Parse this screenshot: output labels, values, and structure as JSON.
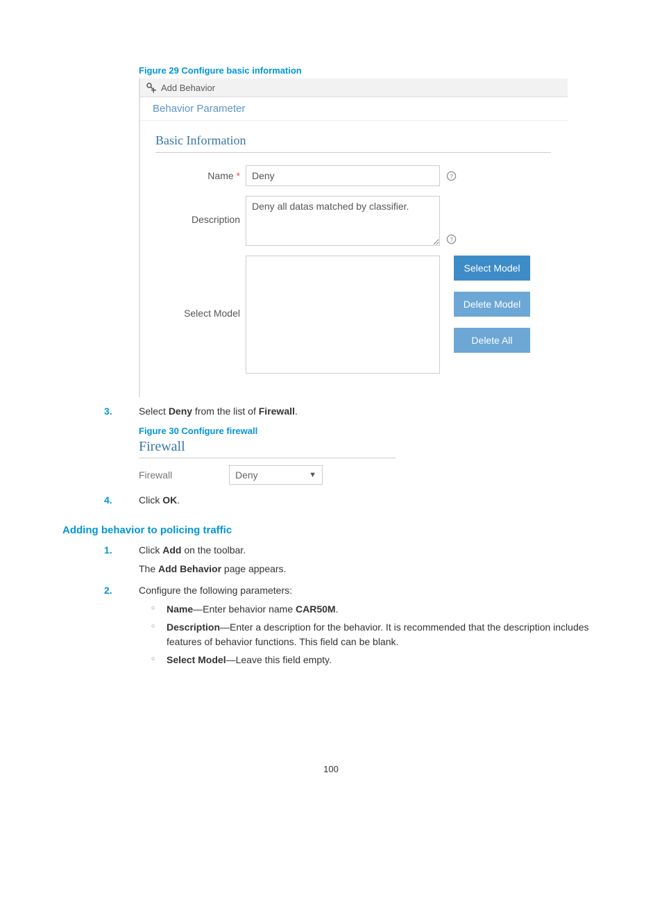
{
  "figure29_caption": "Figure 29 Configure basic information",
  "shot1": {
    "header": "Add Behavior",
    "tab": "Behavior Parameter",
    "section": "Basic Information",
    "name_label": "Name",
    "name_value": "Deny",
    "description_label": "Description",
    "description_value": "Deny all datas matched by classifier.",
    "select_model_label": "Select Model",
    "btn_select_model": "Select Model",
    "btn_delete_model": "Delete Model",
    "btn_delete_all": "Delete All"
  },
  "step3": {
    "num": "3.",
    "prefix": "Select ",
    "bold1": "Deny",
    "mid": " from the list of ",
    "bold2": "Firewall",
    "suffix": "."
  },
  "figure30_caption": "Figure 30 Configure firewall",
  "shot2": {
    "section": "Firewall",
    "label": "Firewall",
    "value": "Deny"
  },
  "step4": {
    "num": "4.",
    "prefix": "Click ",
    "bold": "OK",
    "suffix": "."
  },
  "h3_adding": "Adding behavior to policing traffic",
  "p1": {
    "num": "1.",
    "prefix": "Click ",
    "bold": "Add",
    "suffix": " on the toolbar.",
    "line2a": "The ",
    "line2b": "Add Behavior",
    "line2c": " page appears."
  },
  "p2": {
    "num": "2.",
    "text": "Configure the following parameters:",
    "b1a": "Name",
    "b1b": "—Enter behavior name ",
    "b1c": "CAR50M",
    "b1d": ".",
    "b2a": "Description",
    "b2b": "—Enter a description for the behavior. It is recommended that the description includes features of behavior functions. This field can be blank.",
    "b3a": "Select Model",
    "b3b": "—Leave this field empty."
  },
  "page_number": "100"
}
